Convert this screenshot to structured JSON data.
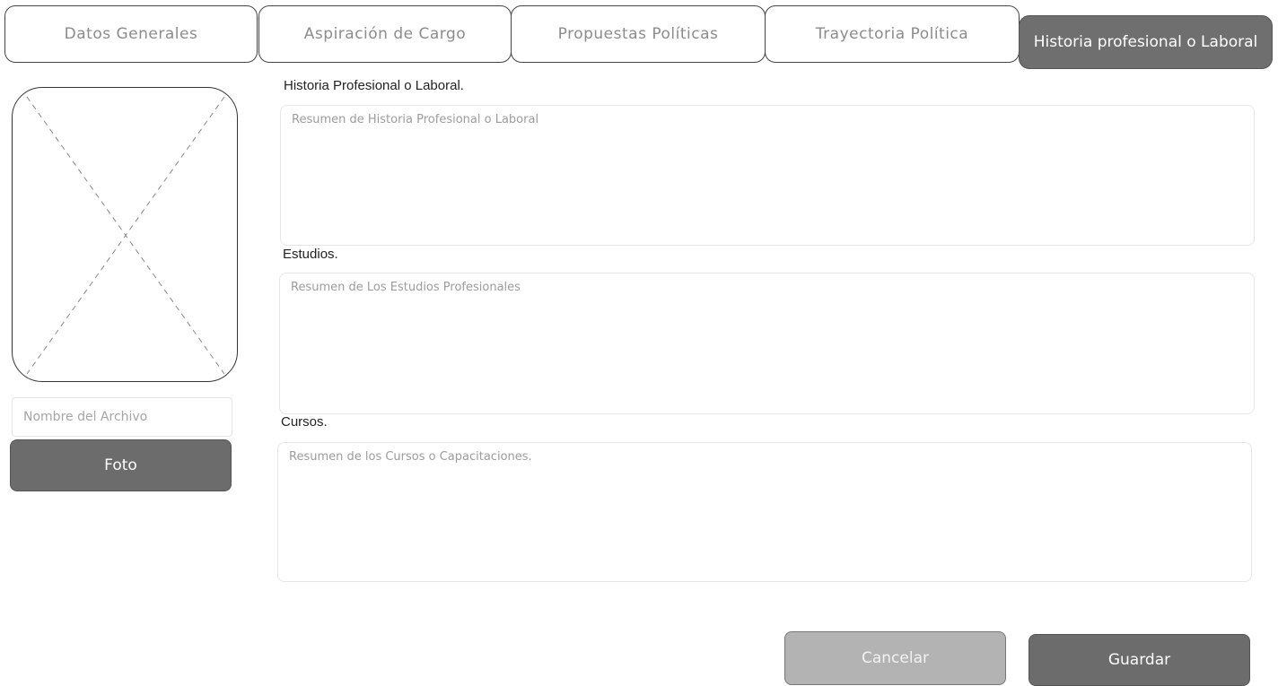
{
  "tabs": [
    {
      "label": "Datos Generales",
      "active": false
    },
    {
      "label": "Aspiración de Cargo",
      "active": false
    },
    {
      "label": "Propuestas Políticas",
      "active": false
    },
    {
      "label": "Trayectoria Política",
      "active": false
    },
    {
      "label": "Historia profesional o Laboral",
      "active": true
    }
  ],
  "photo_panel": {
    "filename_placeholder": "Nombre del Archivo",
    "photo_button": "Foto",
    "placeholder_icon": "image-placeholder-icon"
  },
  "sections": {
    "historia": {
      "label": "Historia Profesional o Laboral.",
      "placeholder": "Resumen de Historia Profesional o Laboral"
    },
    "estudios": {
      "label": "Estudios.",
      "placeholder": "Resumen de Los Estudios Profesionales"
    },
    "cursos": {
      "label": "Cursos.",
      "placeholder": "Resumen de los Cursos o Capacitaciones."
    }
  },
  "actions": {
    "cancel_label": "Cancelar",
    "save_label": "Guardar"
  },
  "colors": {
    "active_tab": "#6f6f6f",
    "primary_button": "#6c6c6c",
    "secondary_button": "#b3b3b3"
  }
}
